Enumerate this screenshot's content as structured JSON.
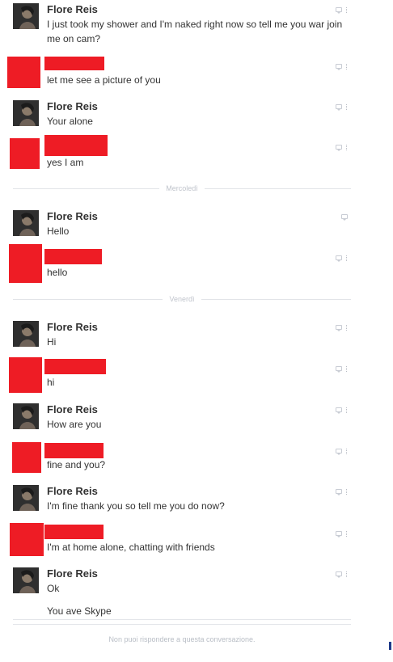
{
  "conversation": {
    "messages": [
      {
        "sender": "Flore Reis",
        "text": "I just took my shower and I'm naked right now so tell me you war join me on cam?",
        "redacted": false
      },
      {
        "sender": "",
        "text": "let me see a picture of you",
        "redacted": true
      },
      {
        "sender": "Flore Reis",
        "text": "Your alone",
        "redacted": false
      },
      {
        "sender": "",
        "text": "yes I am",
        "redacted": true
      },
      {
        "sender": "Flore Reis",
        "text": "Hello",
        "redacted": false
      },
      {
        "sender": "",
        "text": "hello",
        "redacted": true
      },
      {
        "sender": "Flore Reis",
        "text": "Hi",
        "redacted": false
      },
      {
        "sender": "",
        "text": "hi",
        "redacted": true
      },
      {
        "sender": "Flore Reis",
        "text": "How are you",
        "redacted": false
      },
      {
        "sender": "",
        "text": "fine and you?",
        "redacted": true
      },
      {
        "sender": "Flore Reis",
        "text": "I'm fine thank you so tell me you do now?",
        "redacted": false
      },
      {
        "sender": "",
        "text": "I'm at home alone, chatting with friends",
        "redacted": true
      },
      {
        "sender": "Flore Reis",
        "text": "Ok",
        "redacted": false
      },
      {
        "sender": "",
        "text": "You ave Skype",
        "redacted": false
      }
    ],
    "separators": [
      "Mercoledì",
      "Venerdì"
    ],
    "footer": "Non puoi rispondere a questa conversazione."
  },
  "colors": {
    "redaction": "#ee1c25",
    "text": "#333333",
    "muted": "#c0c4cc"
  },
  "icons": [
    "profile-photo-icon",
    "message-bubble-icon"
  ]
}
